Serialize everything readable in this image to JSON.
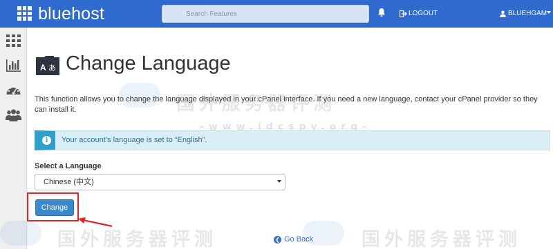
{
  "header": {
    "brand": "bluehost",
    "search_placeholder": "Search Features",
    "logout_label": "LOGOUT",
    "username": "BLUEHGAM"
  },
  "sidebar": {
    "items": [
      {
        "icon": "grid-icon"
      },
      {
        "icon": "bar-chart-icon"
      },
      {
        "icon": "dashboard-icon"
      },
      {
        "icon": "users-icon"
      }
    ]
  },
  "page": {
    "title": "Change Language",
    "title_icon_letters": {
      "left": "A",
      "right": "あ"
    },
    "description": "This function allows you to change the language displayed in your cPanel interface. If you need a new language, contact your cPanel provider so they can install it.",
    "info_message": "Your account’s language is set to “English”.",
    "select_label": "Select a Language",
    "selected_language": "Chinese (中文)",
    "change_button": "Change",
    "go_back": "Go Back"
  },
  "watermark": {
    "text_cn": "国外服务器评测",
    "url": "-www.idcspy.org-"
  },
  "colors": {
    "header_bg": "#2f6bce",
    "info_bg": "#d9edf7",
    "info_accent": "#31a0c8",
    "button_bg": "#3a87c9",
    "highlight": "#e1242a"
  }
}
